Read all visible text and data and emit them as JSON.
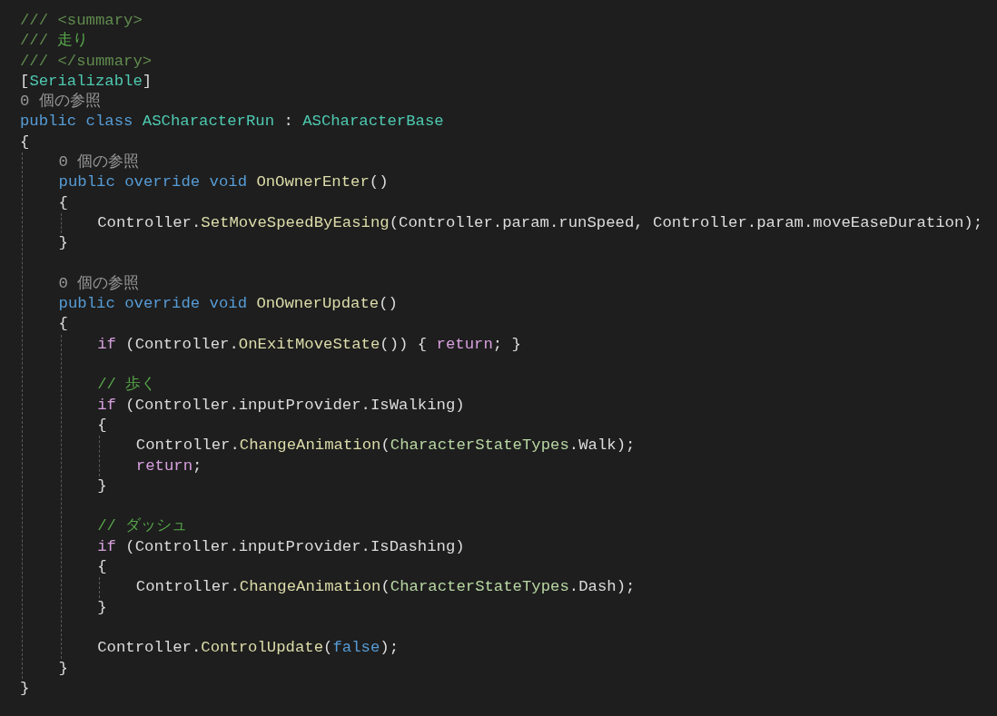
{
  "editor": {
    "lines": [
      {
        "kind": "code",
        "tokens": [
          {
            "kind": "doc",
            "text": "/// "
          },
          {
            "kind": "doctag",
            "text": "<summary>"
          }
        ]
      },
      {
        "kind": "code",
        "tokens": [
          {
            "kind": "doc",
            "text": "/// "
          },
          {
            "kind": "comment",
            "text": "走り"
          }
        ]
      },
      {
        "kind": "code",
        "tokens": [
          {
            "kind": "doc",
            "text": "/// "
          },
          {
            "kind": "doctag",
            "text": "</summary>"
          }
        ]
      },
      {
        "kind": "code",
        "tokens": [
          {
            "kind": "plain",
            "text": "["
          },
          {
            "kind": "type",
            "text": "Serializable"
          },
          {
            "kind": "plain",
            "text": "]"
          }
        ]
      },
      {
        "kind": "codelens",
        "text": "0 個の参照"
      },
      {
        "kind": "code",
        "tokens": [
          {
            "kind": "keyword",
            "text": "public class "
          },
          {
            "kind": "type",
            "text": "ASCharacterRun"
          },
          {
            "kind": "plain",
            "text": " : "
          },
          {
            "kind": "type",
            "text": "ASCharacterBase"
          }
        ]
      },
      {
        "kind": "code",
        "tokens": [
          {
            "kind": "plain",
            "text": "{"
          }
        ]
      },
      {
        "kind": "block",
        "children": [
          {
            "kind": "codelens",
            "text": "0 個の参照"
          },
          {
            "kind": "code",
            "tokens": [
              {
                "kind": "keyword",
                "text": "public override void "
              },
              {
                "kind": "method",
                "text": "OnOwnerEnter"
              },
              {
                "kind": "plain",
                "text": "()"
              }
            ]
          },
          {
            "kind": "code",
            "tokens": [
              {
                "kind": "plain",
                "text": "{"
              }
            ]
          },
          {
            "kind": "block",
            "children": [
              {
                "kind": "code",
                "tokens": [
                  {
                    "kind": "plain",
                    "text": "Controller."
                  },
                  {
                    "kind": "method",
                    "text": "SetMoveSpeedByEasing"
                  },
                  {
                    "kind": "plain",
                    "text": "(Controller.param.runSpeed, Controller.param.moveEaseDuration);"
                  }
                ]
              }
            ]
          },
          {
            "kind": "code",
            "tokens": [
              {
                "kind": "plain",
                "text": "}"
              }
            ]
          },
          {
            "kind": "blank"
          },
          {
            "kind": "codelens",
            "text": "0 個の参照"
          },
          {
            "kind": "code",
            "tokens": [
              {
                "kind": "keyword",
                "text": "public override void "
              },
              {
                "kind": "method",
                "text": "OnOwnerUpdate"
              },
              {
                "kind": "plain",
                "text": "()"
              }
            ]
          },
          {
            "kind": "code",
            "tokens": [
              {
                "kind": "plain",
                "text": "{"
              }
            ]
          },
          {
            "kind": "block",
            "children": [
              {
                "kind": "code",
                "tokens": [
                  {
                    "kind": "control",
                    "text": "if"
                  },
                  {
                    "kind": "plain",
                    "text": " (Controller."
                  },
                  {
                    "kind": "method",
                    "text": "OnExitMoveState"
                  },
                  {
                    "kind": "plain",
                    "text": "()) { "
                  },
                  {
                    "kind": "control",
                    "text": "return"
                  },
                  {
                    "kind": "plain",
                    "text": "; }"
                  }
                ]
              },
              {
                "kind": "blank"
              },
              {
                "kind": "code",
                "tokens": [
                  {
                    "kind": "comment",
                    "text": "// 歩く"
                  }
                ]
              },
              {
                "kind": "code",
                "tokens": [
                  {
                    "kind": "control",
                    "text": "if"
                  },
                  {
                    "kind": "plain",
                    "text": " (Controller.inputProvider.IsWalking)"
                  }
                ]
              },
              {
                "kind": "code",
                "tokens": [
                  {
                    "kind": "plain",
                    "text": "{"
                  }
                ]
              },
              {
                "kind": "block",
                "children": [
                  {
                    "kind": "code",
                    "tokens": [
                      {
                        "kind": "plain",
                        "text": "Controller."
                      },
                      {
                        "kind": "method",
                        "text": "ChangeAnimation"
                      },
                      {
                        "kind": "plain",
                        "text": "("
                      },
                      {
                        "kind": "enum",
                        "text": "CharacterStateTypes"
                      },
                      {
                        "kind": "plain",
                        "text": ".Walk);"
                      }
                    ]
                  },
                  {
                    "kind": "code",
                    "tokens": [
                      {
                        "kind": "control",
                        "text": "return"
                      },
                      {
                        "kind": "plain",
                        "text": ";"
                      }
                    ]
                  }
                ]
              },
              {
                "kind": "code",
                "tokens": [
                  {
                    "kind": "plain",
                    "text": "}"
                  }
                ]
              },
              {
                "kind": "blank"
              },
              {
                "kind": "code",
                "tokens": [
                  {
                    "kind": "comment",
                    "text": "// ダッシュ"
                  }
                ]
              },
              {
                "kind": "code",
                "tokens": [
                  {
                    "kind": "control",
                    "text": "if"
                  },
                  {
                    "kind": "plain",
                    "text": " (Controller.inputProvider.IsDashing)"
                  }
                ]
              },
              {
                "kind": "code",
                "tokens": [
                  {
                    "kind": "plain",
                    "text": "{"
                  }
                ]
              },
              {
                "kind": "block",
                "children": [
                  {
                    "kind": "code",
                    "tokens": [
                      {
                        "kind": "plain",
                        "text": "Controller."
                      },
                      {
                        "kind": "method",
                        "text": "ChangeAnimation"
                      },
                      {
                        "kind": "plain",
                        "text": "("
                      },
                      {
                        "kind": "enum",
                        "text": "CharacterStateTypes"
                      },
                      {
                        "kind": "plain",
                        "text": ".Dash);"
                      }
                    ]
                  }
                ]
              },
              {
                "kind": "code",
                "tokens": [
                  {
                    "kind": "plain",
                    "text": "}"
                  }
                ]
              },
              {
                "kind": "blank"
              },
              {
                "kind": "code",
                "tokens": [
                  {
                    "kind": "plain",
                    "text": "Controller."
                  },
                  {
                    "kind": "method",
                    "text": "ControlUpdate"
                  },
                  {
                    "kind": "plain",
                    "text": "("
                  },
                  {
                    "kind": "keyword",
                    "text": "false"
                  },
                  {
                    "kind": "plain",
                    "text": ");"
                  }
                ]
              }
            ]
          },
          {
            "kind": "code",
            "tokens": [
              {
                "kind": "plain",
                "text": "}"
              }
            ]
          }
        ]
      },
      {
        "kind": "code",
        "tokens": [
          {
            "kind": "plain",
            "text": "}"
          }
        ]
      }
    ]
  }
}
